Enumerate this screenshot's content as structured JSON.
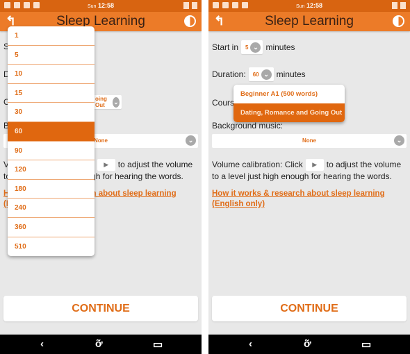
{
  "statusbar": {
    "day": "Sun",
    "time": "12:58"
  },
  "appbar": {
    "back_icon": "↰",
    "title": "Sleep Learning",
    "contrast_icon": "contrast-icon"
  },
  "form": {
    "start_label": "Start in",
    "start_value": "5",
    "minutes_label": "minutes",
    "duration_label": "Duration:",
    "duration_value": "60",
    "course_label": "Course:",
    "course_value": "Dating, Romance and Going Out",
    "course_value_partial": "oing Out",
    "background_label": "Background music:",
    "background_value": "None",
    "background_value_partial": "one",
    "volume_text_before": "Volume calibration: Click",
    "volume_text_after": "to adjust the volume to a level just high enough for hearing the words.",
    "play_icon": "▶",
    "link_text": "How it works & research about sleep learning (English only)",
    "continue_label": "CONTINUE"
  },
  "duration_dropdown": {
    "options": [
      "1",
      "5",
      "10",
      "15",
      "30",
      "60",
      "90",
      "120",
      "180",
      "240",
      "360",
      "510"
    ],
    "selected": "60"
  },
  "course_dropdown": {
    "options": [
      "Beginner A1 (500 words)",
      "Dating, Romance and Going Out"
    ],
    "selected": "Dating, Romance and Going Out"
  },
  "navbar": {
    "back": "‹",
    "home": "ỡ",
    "recent": "▭"
  },
  "colors": {
    "accent": "#ec7b28",
    "statusbar": "#d86411",
    "selected": "#e0670f",
    "text_accent": "#e06d18",
    "background": "#e8e8e8"
  }
}
